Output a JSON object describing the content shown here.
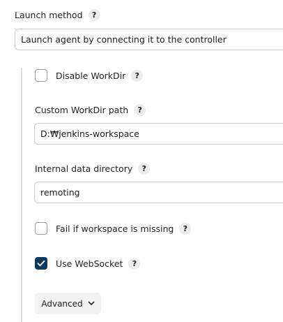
{
  "launch_method": {
    "label": "Launch method",
    "help": "?",
    "value": "Launch agent by connecting it to the controller"
  },
  "disable_workdir": {
    "label": "Disable WorkDir",
    "help": "?",
    "checked": false
  },
  "custom_workdir": {
    "label": "Custom WorkDir path",
    "help": "?",
    "value": "D:₩jenkins-workspace"
  },
  "internal_data_dir": {
    "label": "Internal data directory",
    "help": "?",
    "value": "remoting"
  },
  "fail_if_missing": {
    "label": "Fail if workspace is missing",
    "help": "?",
    "checked": false
  },
  "use_websocket": {
    "label": "Use WebSocket",
    "help": "?",
    "checked": true
  },
  "advanced": {
    "label": "Advanced",
    "icon": "chevron-down-icon"
  },
  "colors": {
    "checkbox_checked": "#0b3a5c",
    "help_bg": "#ececee",
    "button_bg": "#f2f2f4",
    "border": "#c9cacd"
  }
}
